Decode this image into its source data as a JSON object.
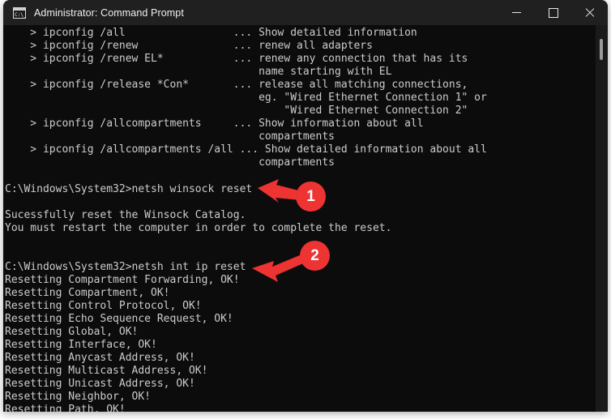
{
  "window": {
    "title": "Administrator: Command Prompt",
    "icon": "command-prompt-icon",
    "controls": {
      "minimize": "Minimize",
      "maximize": "Maximize",
      "close": "Close"
    }
  },
  "colors": {
    "console_background": "#0c0c0c",
    "console_text": "#cccccc",
    "titlebar_background": "#202020",
    "annotation_red": "#ee3333",
    "scrollbar_thumb": "#9a9a9a"
  },
  "console": {
    "text": "    > ipconfig /all                 ... Show detailed information\n    > ipconfig /renew               ... renew all adapters\n    > ipconfig /renew EL*           ... renew any connection that has its\n                                        name starting with EL\n    > ipconfig /release *Con*       ... release all matching connections,\n                                        eg. \"Wired Ethernet Connection 1\" or\n                                            \"Wired Ethernet Connection 2\"\n    > ipconfig /allcompartments     ... Show information about all\n                                        compartments\n    > ipconfig /allcompartments /all ... Show detailed information about all\n                                        compartments\n\nC:\\Windows\\System32>netsh winsock reset\n\nSucessfully reset the Winsock Catalog.\nYou must restart the computer in order to complete the reset.\n\n\nC:\\Windows\\System32>netsh int ip reset\nResetting Compartment Forwarding, OK!\nResetting Compartment, OK!\nResetting Control Protocol, OK!\nResetting Echo Sequence Request, OK!\nResetting Global, OK!\nResetting Interface, OK!\nResetting Anycast Address, OK!\nResetting Multicast Address, OK!\nResetting Unicast Address, OK!\nResetting Neighbor, OK!\nResetting Path, OK!",
    "lines": [
      "    > ipconfig /all                 ... Show detailed information",
      "    > ipconfig /renew               ... renew all adapters",
      "    > ipconfig /renew EL*           ... renew any connection that has its",
      "                                        name starting with EL",
      "    > ipconfig /release *Con*       ... release all matching connections,",
      "                                        eg. \"Wired Ethernet Connection 1\" or",
      "                                            \"Wired Ethernet Connection 2\"",
      "    > ipconfig /allcompartments     ... Show information about all",
      "                                        compartments",
      "    > ipconfig /allcompartments /all ... Show detailed information about all",
      "                                        compartments",
      "",
      "C:\\Windows\\System32>netsh winsock reset",
      "",
      "Sucessfully reset the Winsock Catalog.",
      "You must restart the computer in order to complete the reset.",
      "",
      "",
      "C:\\Windows\\System32>netsh int ip reset",
      "Resetting Compartment Forwarding, OK!",
      "Resetting Compartment, OK!",
      "Resetting Control Protocol, OK!",
      "Resetting Echo Sequence Request, OK!",
      "Resetting Global, OK!",
      "Resetting Interface, OK!",
      "Resetting Anycast Address, OK!",
      "Resetting Multicast Address, OK!",
      "Resetting Unicast Address, OK!",
      "Resetting Neighbor, OK!",
      "Resetting Path, OK!"
    ],
    "commands": [
      "netsh winsock reset",
      "netsh int ip reset"
    ],
    "prompt": "C:\\Windows\\System32>"
  },
  "annotations": [
    {
      "number": "1",
      "target_command": "netsh winsock reset"
    },
    {
      "number": "2",
      "target_command": "netsh int ip reset"
    }
  ]
}
